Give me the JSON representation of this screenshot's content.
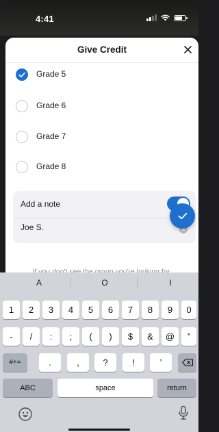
{
  "status_bar": {
    "time": "4:41"
  },
  "sheet": {
    "title": "Give Credit",
    "grades": [
      {
        "label": "Grade 5",
        "checked": true
      },
      {
        "label": "Grade 6",
        "checked": false
      },
      {
        "label": "Grade 7",
        "checked": false
      },
      {
        "label": "Grade 8",
        "checked": false
      }
    ],
    "note": {
      "label": "Add a note",
      "toggle_on": true,
      "value": "Joe S."
    },
    "hint": "If you don't see the group you're looking for,"
  },
  "keyboard": {
    "suggestions": [
      "A",
      "O",
      "I"
    ],
    "row1": [
      "1",
      "2",
      "3",
      "4",
      "5",
      "6",
      "7",
      "8",
      "9",
      "0"
    ],
    "row2": [
      "-",
      "/",
      ":",
      ";",
      "(",
      ")",
      "$",
      "&",
      "@",
      "”"
    ],
    "row3_toggle": "#+=",
    "row3": [
      ".",
      ",",
      "?",
      "!",
      "’"
    ],
    "abc_label": "ABC",
    "space_label": "space",
    "return_label": "return"
  },
  "colors": {
    "accent": "#1f6fd0",
    "keyboard_bg": "#d2d4da",
    "card_bg": "#f2f2f5"
  }
}
